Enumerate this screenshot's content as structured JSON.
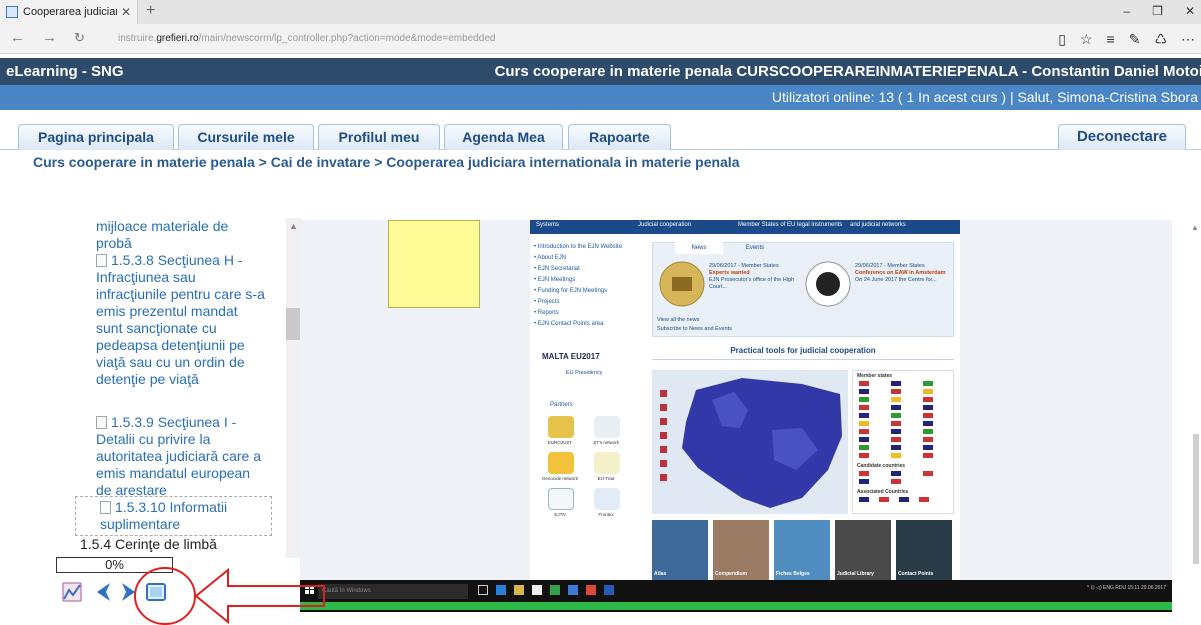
{
  "browser": {
    "tab_title": "Cooperarea judiciara int",
    "tab_close": "✕",
    "new_tab": "+",
    "url_prefix": "instruire.",
    "url_domain": "grefieri.ro",
    "url_path": "/main/newscorm/lp_controller.php?action=mode&mode=embedded",
    "window_minimize": "–",
    "window_restore": "❐",
    "window_close": "✕"
  },
  "site": {
    "name": "eLearning - SNG",
    "course_title": "Curs cooperare in materie penala CURSCOOPERAREINMATERIEPENALA - Constantin Daniel Motoi",
    "user_info": "Utilizatori online:  13  ( 1 In acest curs  ) | Salut, Simona-Cristina Sbora"
  },
  "menu": {
    "tabs": [
      {
        "label": "Pagina principala"
      },
      {
        "label": "Cursurile mele"
      },
      {
        "label": "Profilul meu"
      },
      {
        "label": "Agenda Mea"
      },
      {
        "label": "Rapoarte"
      }
    ],
    "logout": "Deconectare"
  },
  "breadcrumb": "Curs cooperare in materie penala > Cai de invatare > Cooperarea judiciara internationala in materie penala",
  "toc": {
    "items": [
      {
        "text": "mijloace materiale de probă"
      },
      {
        "text": "1.5.3.8 Secţiunea H - Infracţiunea sau infracţiunile pentru care s-a emis prezentul mandat sunt sancţionate cu pedeapsa detenţiunii pe viaţă sau cu un ordin de detenţie pe viaţă"
      },
      {
        "text": "1.5.3.9 Secţiunea I - Detalii cu privire la autoritatea judiciară care a emis mandatul european de arestare"
      },
      {
        "text": "1.5.3.10 Informatii suplimentare"
      }
    ],
    "section": "1.5.4 Cerinţe de limbă",
    "progress_text": "0%",
    "progress_value": 0
  },
  "embedded": {
    "top_nav": [
      "Systems",
      "Judicial cooperation",
      "Member States of EU legal instruments",
      "and judicial networks"
    ],
    "left_nav": [
      "• Introduction to the EJN Website",
      "• About EJN",
      "• EJN Secretariat",
      "• EJN Meetings",
      "• Funding for EJN Meetings",
      "• Projects",
      "• Reports",
      "• EJN Contact Points area"
    ],
    "news_tabs": [
      "News",
      "Events"
    ],
    "news_1_date": "29/06/2017 - Member States",
    "news_1_title": "Experts wanted",
    "news_1_body": "EJN Prosecutor's office of the High Court...",
    "news_2_date": "29/06/2017 - Member States",
    "news_2_title": "Conference on EAW in Amsterdam",
    "news_2_body": "On 24 June 2017 the Centre for...",
    "view_all": "View all the news",
    "subscribe": "Subscribe to News and Events",
    "malta": "MALTA EU2017",
    "presidency": "EU Presidency",
    "partners": "Partners",
    "partner_labels": [
      "EUROJUST",
      "JIT's network",
      "Genocide network",
      "EU-Trad",
      "EJTN",
      "Frontex"
    ],
    "practical_tools": "Practical tools for judicial cooperation",
    "flags_title": "Member states",
    "candidates_title": "Candidate countries",
    "associated_title": "Associated Countries",
    "tiles": [
      "Atlas",
      "Compendium",
      "Fiches Belges",
      "Judicial Library",
      "Contact Points"
    ]
  },
  "taskbar": {
    "search_placeholder": "Caută în Windows",
    "tray": "^  ⊡ ◁)  ENG  RDU  15:11  29.06.2017"
  },
  "colors": {
    "header_dark": "#2e4b6b",
    "header_blue": "#4a86c5",
    "tab_text": "#1f4d86",
    "annotation_red": "#e0201f"
  }
}
